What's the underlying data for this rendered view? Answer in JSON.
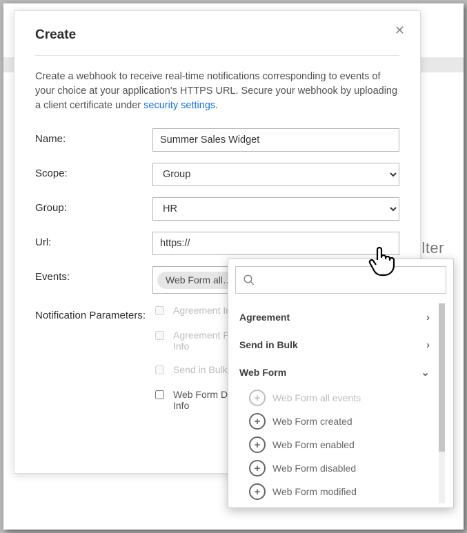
{
  "modal": {
    "title": "Create",
    "intro_prefix": "Create a webhook to receive real-time notifications corresponding to events of your choice at your application's HTTPS URL. Secure your webhook by uploading a client certificate under ",
    "intro_link": "security settings",
    "intro_suffix": "."
  },
  "labels": {
    "name": "Name:",
    "scope": "Scope:",
    "group": "Group:",
    "url": "Url:",
    "events": "Events:",
    "params": "Notification Parameters:"
  },
  "fields": {
    "name_value": "Summer Sales Widget",
    "scope_value": "Group",
    "group_value": "HR",
    "url_value": "https://",
    "event_chip": "Web Form all…"
  },
  "params": {
    "opt1": "Agreement Info",
    "opt2a": "Agreement Participant",
    "opt2b": "Info",
    "opt3": "Send in Bulk Info",
    "opt4a": "Web Form Document",
    "opt4b": "Info"
  },
  "popover": {
    "cat_agreement": "Agreement",
    "cat_sendbulk": "Send in Bulk",
    "cat_webform": "Web Form",
    "wf_all": "Web Form all events",
    "wf_created": "Web Form created",
    "wf_enabled": "Web Form enabled",
    "wf_disabled": "Web Form disabled",
    "wf_modified": "Web Form modified"
  },
  "bg": {
    "filter": "ilter"
  }
}
